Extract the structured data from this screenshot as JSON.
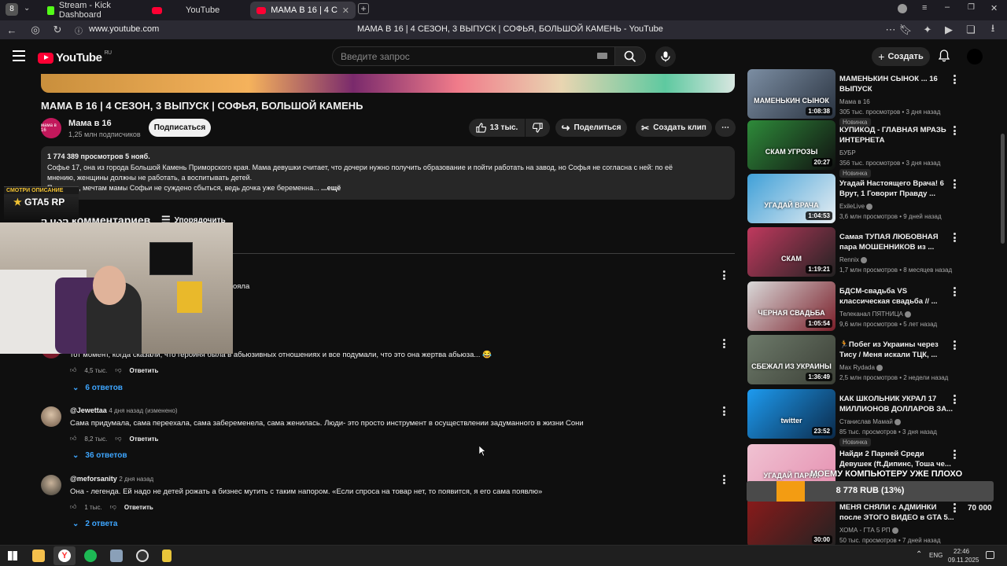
{
  "browser": {
    "profile_badge": "8",
    "tabs": [
      {
        "label": "Stream - Kick Dashboard"
      },
      {
        "label": "YouTube"
      },
      {
        "label": "МАМА В 16 | 4 СЕЗОН, 3"
      }
    ],
    "url": "www.youtube.com",
    "page_title": "МАМА В 16 | 4 СЕЗОН, 3 ВЫПУСК | СОФЬЯ, БОЛЬШОЙ КАМЕНЬ - YouTube"
  },
  "youtube": {
    "logo": "YouTube",
    "region": "RU",
    "search_placeholder": "Введите запрос",
    "create_label": "Создать"
  },
  "video": {
    "title": "МАМА В 16 | 4 СЕЗОН, 3 ВЫПУСК | СОФЬЯ, БОЛЬШОЙ КАМЕНЬ",
    "channel": "Мама в 16",
    "channel_avatar_text": "мама в 16",
    "subscribers": "1,25 млн подписчиков",
    "subscribe_label": "Подписаться",
    "likes": "13 тыс.",
    "share_label": "Поделиться",
    "clip_label": "Создать клип",
    "description": {
      "stats": "1 774 389 просмотров  5 нояб.",
      "line1": "Софье 17, она из города Большой Камень Приморского края. Мама девушки считает, что дочери нужно получить образование и пойти работать на завод, но Софья не согласна с ней: по её",
      "line2": "мнению, женщины должны не работать, а воспитывать детей.",
      "line3": "Пытается, мечтам мамы Софьи не суждено сбыться, ведь дочка уже беременна...",
      "more": "...ещё"
    }
  },
  "comments": {
    "count_label": "5 035 комментариев",
    "sort_label": "Упорядочить",
    "partial_text": "ояла",
    "items": [
      {
        "author": "",
        "date": "",
        "text": "тот момент, когда сказали, что героиня была в абьюзивных отношениях и все подумали, что это она жертва абьюза... 😂",
        "likes": "4,5 тыс.",
        "reply": "Ответить",
        "replies": "6 ответов"
      },
      {
        "author": "@Jewettaa",
        "date": "4 дня назад (изменено)",
        "text": "Сама придумала, сама переехала, сама забеременела, сама женилась. Люди- это просто инструмент в осуществлении задуманного в жизни Сони",
        "likes": "8,2 тыс.",
        "reply": "Ответить",
        "replies": "36 ответов"
      },
      {
        "author": "@meforsanity",
        "date": "2 дня назад",
        "text": "Она - легенда. Ей надо не детей рожать а бизнес мутить с таким напором. «Если спроса на товар нет, то появится, я его сама появлю»",
        "likes": "1 тыс.",
        "reply": "Ответить",
        "replies": "2 ответа"
      }
    ]
  },
  "overlay": {
    "gta_top": "СМОТРИ ОПИСАНИЕ",
    "gta_logo": "GTA5 RP",
    "donation_header": "МОЕМУ КОМПЬЮТЕРУ УЖЕ ПЛОХО",
    "donation_amount": "8 778 RUB (13%)",
    "donation_goal": "70 000",
    "donation_progress": 0.13
  },
  "recommendations": [
    {
      "title_l1": "МАМЕНЬКИН СЫНОК ... 16",
      "title_l2": "ВЫПУСК",
      "channel": "Мама в 16",
      "verified": false,
      "meta": "305 тыс. просмотров • 3 дня назад",
      "badge": "Новинка",
      "duration": "1:08:38",
      "thumb_text": "МАМЕНЬКИН СЫНОК",
      "colors": [
        "#7c8ea3",
        "#2a3340"
      ]
    },
    {
      "title_l1": "КУПИКОД - ГЛАВНАЯ МРАЗЬ",
      "title_l2": "ИНТЕРНЕТА",
      "channel": "БУБР",
      "verified": false,
      "meta": "356 тыс. просмотров • 3 дня назад",
      "badge": "Новинка",
      "duration": "20:27",
      "thumb_text": "СКАМ УГРОЗЫ",
      "colors": [
        "#2e8b3a",
        "#111"
      ]
    },
    {
      "title_l1": "Угадай Настоящего Врача! 6",
      "title_l2": "Врут, 1 Говорит Правду ...",
      "channel": "ExileLive",
      "verified": true,
      "meta": "3,6 млн просмотров • 9 дней назад",
      "badge": "",
      "duration": "1:04:53",
      "thumb_text": "УГАДАЙ ВРАЧА",
      "colors": [
        "#3fa0d8",
        "#e8eef2"
      ]
    },
    {
      "title_l1": "Самая ТУПАЯ ЛЮБОВНАЯ",
      "title_l2": "пара МОШЕННИКОВ из ...",
      "channel": "Rennix",
      "verified": true,
      "meta": "1,7 млн просмотров • 8 месяцев назад",
      "badge": "",
      "duration": "1:19:21",
      "thumb_text": "СКАМ",
      "colors": [
        "#c0395e",
        "#222"
      ]
    },
    {
      "title_l1": "БДСМ-свадьба VS",
      "title_l2": "классическая свадьба // ...",
      "channel": "Телеканал ПЯТНИЦА",
      "verified": true,
      "meta": "9,6 млн просмотров • 5 лет назад",
      "badge": "",
      "duration": "1:05:54",
      "thumb_text": "ЧЕРНАЯ СВАДЬБА",
      "colors": [
        "#d9d9d9",
        "#7a1f2a"
      ]
    },
    {
      "title_l1": "🏃Побег из Украины через",
      "title_l2": "Тису / Меня искали ТЦК, ...",
      "channel": "Max Rydada",
      "verified": true,
      "meta": "2,5 млн просмотров • 2 недели назад",
      "badge": "",
      "duration": "1:36:49",
      "thumb_text": "СБЕЖАЛ ИЗ УКРАИНЫ",
      "colors": [
        "#6d7a6a",
        "#3b3f36"
      ]
    },
    {
      "title_l1": "КАК ШКОЛЬНИК УКРАЛ 17",
      "title_l2": "МИЛЛИОНОВ ДОЛЛАРОВ ЗА...",
      "channel": "Станислав Мамай",
      "verified": true,
      "meta": "85 тыс. просмотров • 3 дня назад",
      "badge": "Новинка",
      "duration": "23:52",
      "thumb_text": "twitter",
      "colors": [
        "#1d9bf0",
        "#0b2a4a"
      ]
    },
    {
      "title_l1": "Найди 2 Парней Среди",
      "title_l2": "Девушек (ft.Дипинс, Тоша че...",
      "channel": "",
      "verified": false,
      "meta": "",
      "badge": "",
      "duration": "",
      "thumb_text": "УГАДАЙ ПАРНЯ",
      "colors": [
        "#f0c2d2",
        "#e58fb0"
      ]
    },
    {
      "title_l1": "МЕНЯ СНЯЛИ с АДМИНКИ",
      "title_l2": "после ЭТОГО ВИДЕО в GTA 5...",
      "channel": "ХОМА - ГТА 5 РП",
      "verified": true,
      "meta": "50 тыс. просмотров • 7 дней назад",
      "badge": "",
      "duration": "30:00",
      "thumb_text": "",
      "colors": [
        "#8b1a1a",
        "#222"
      ]
    }
  ],
  "taskbar": {
    "lang": "ENG",
    "time": "22:46",
    "date": "09.11.2025"
  }
}
